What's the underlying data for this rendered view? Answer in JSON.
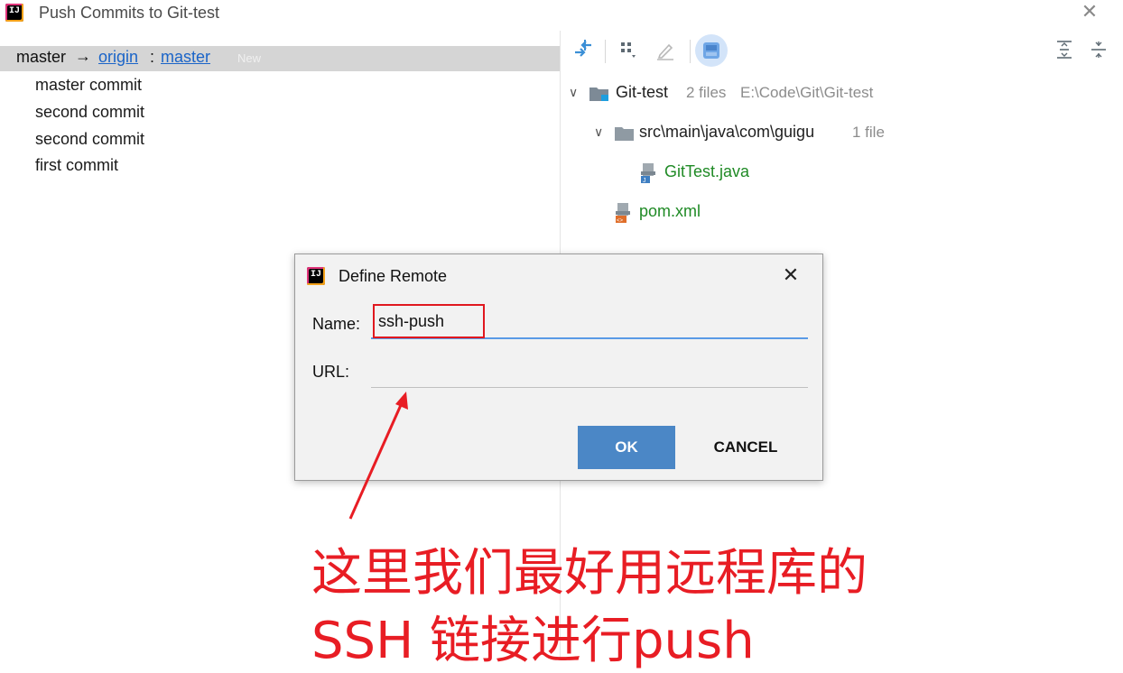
{
  "window": {
    "title": "Push Commits to Git-test",
    "close_glyph": "✕"
  },
  "branch": {
    "local": "master",
    "arrow": "→",
    "remote": "origin",
    "colon": ":",
    "target": "master",
    "badge": "New"
  },
  "commits": [
    "master commit",
    "second commit",
    "second commit",
    "first commit"
  ],
  "toolbar": {
    "icons": [
      "diff-arrow-icon",
      "group-by-icon",
      "edit-icon",
      "preview-icon",
      "expand-all-icon",
      "collapse-all-icon"
    ]
  },
  "tree": {
    "root": {
      "name": "Git-test",
      "meta": "2 files",
      "path": "E:\\Code\\Git\\Git-test"
    },
    "folder": {
      "name": "src\\main\\java\\com\\guigu",
      "meta": "1 file"
    },
    "files": [
      "GitTest.java",
      "pom.xml"
    ],
    "chevron": "∨"
  },
  "dialog": {
    "title": "Define Remote",
    "close_glyph": "✕",
    "name_label": "Name:",
    "name_value": "ssh-push",
    "url_label": "URL:",
    "url_value": "",
    "ok_label": "OK",
    "cancel_label": "CANCEL"
  },
  "annotation": {
    "line1": "这里我们最好用远程库的",
    "line2": "SSH 链接进行push",
    "color": "#e81d24"
  },
  "colors": {
    "link": "#1a64c8",
    "added_file": "#1f8a25",
    "ok_button": "#4b87c6",
    "focus_underline": "#5a9be6"
  }
}
